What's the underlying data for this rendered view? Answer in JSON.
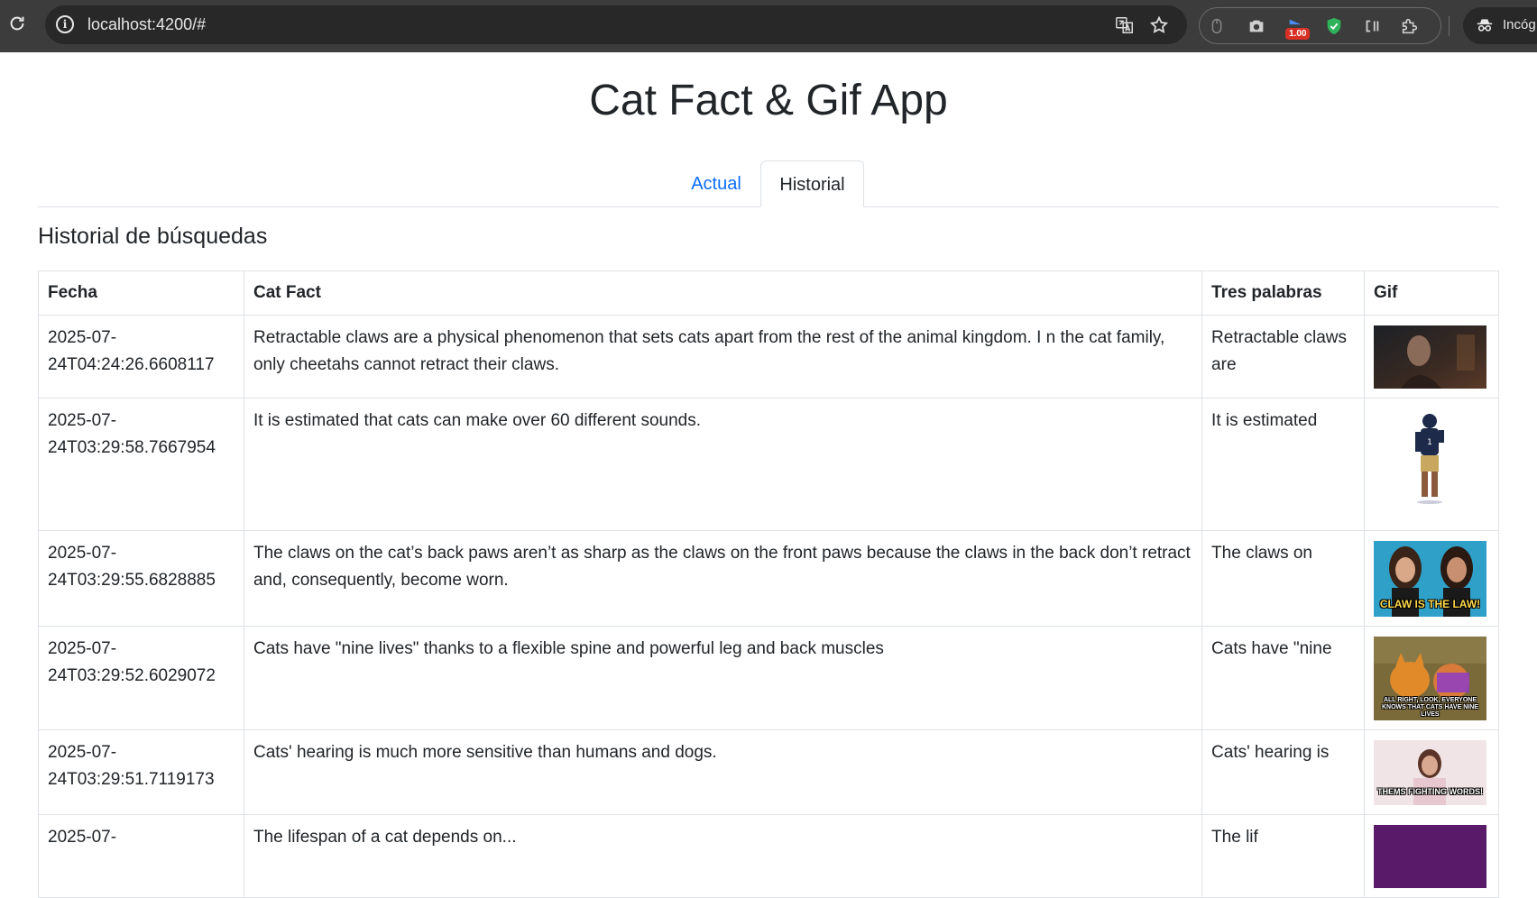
{
  "browser": {
    "url": "localhost:4200/#",
    "extension_badge": "1.00",
    "profile_label": "Incóg"
  },
  "app": {
    "title": "Cat Fact & Gif App",
    "tabs": [
      {
        "label": "Actual",
        "active": false
      },
      {
        "label": "Historial",
        "active": true
      }
    ],
    "section_title": "Historial de búsquedas"
  },
  "table": {
    "headers": {
      "fecha": "Fecha",
      "fact": "Cat Fact",
      "tres": "Tres palabras",
      "gif": "Gif"
    },
    "rows": [
      {
        "fecha_line1": "2025-07-",
        "fecha_line2": "24T04:24:26.6608117",
        "fact": "Retractable claws are a physical phenomenon that sets cats apart from the rest of the animal kingdom. I n the cat family, only cheetahs cannot retract their claws.",
        "tres": "Retractable claws are",
        "gif_caption": ""
      },
      {
        "fecha_line1": "2025-07-",
        "fecha_line2": "24T03:29:58.7667954",
        "fact": "It is estimated that cats can make over 60 different sounds.",
        "tres": "It is estimated",
        "gif_caption": ""
      },
      {
        "fecha_line1": "2025-07-",
        "fecha_line2": "24T03:29:55.6828885",
        "fact": "The claws on the cat’s back paws aren’t as sharp as the claws on the front paws because the claws in the back don’t retract and, consequently, become worn.",
        "tres": "The claws on",
        "gif_caption": "CLAW IS THE LAW!"
      },
      {
        "fecha_line1": "2025-07-",
        "fecha_line2": "24T03:29:52.6029072",
        "fact": "Cats have \"nine lives\" thanks to a flexible spine and powerful leg and back muscles",
        "tres": "Cats have \"nine",
        "gif_caption": "ALL RIGHT, LOOK, EVERYONE KNOWS THAT CATS HAVE NINE LIVES"
      },
      {
        "fecha_line1": "2025-07-",
        "fecha_line2": "24T03:29:51.7119173",
        "fact": "Cats' hearing is much more sensitive than humans and dogs.",
        "tres": "Cats' hearing is",
        "gif_caption": "THEMS FIGHTING WORDS!"
      },
      {
        "fecha_line1": "2025-07-",
        "fecha_line2": "",
        "fact": "The lifespan of a cat depends on...",
        "tres": "The lif",
        "gif_caption": ""
      }
    ]
  },
  "colors": {
    "link": "#0d6efd",
    "border": "#dee2e6",
    "chrome": "#3c3c3c",
    "omnibox": "#282828"
  }
}
